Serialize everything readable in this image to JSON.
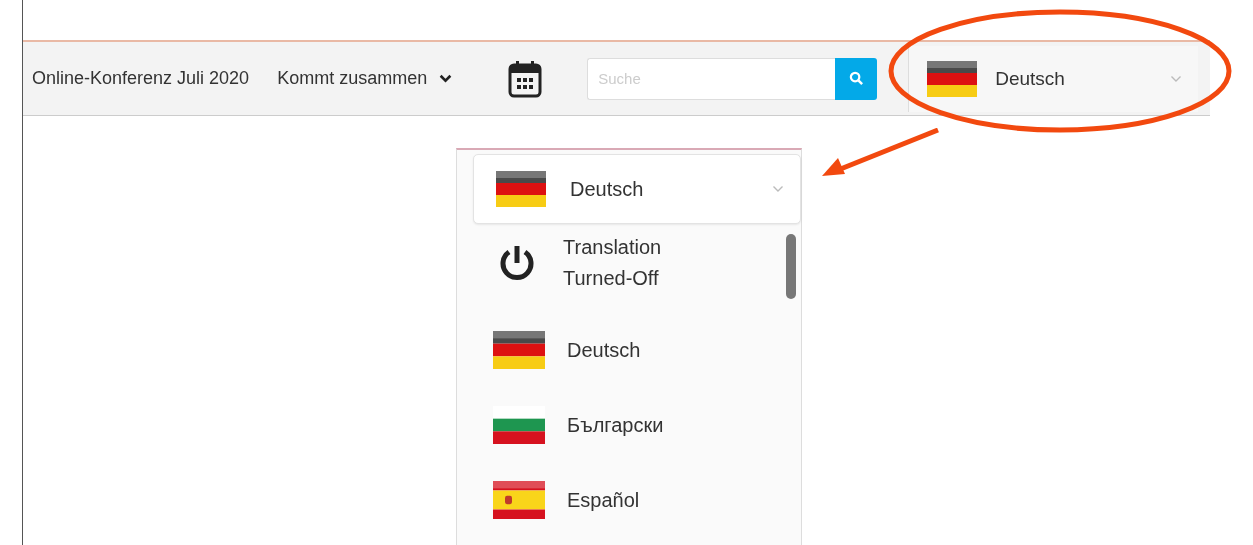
{
  "header": {
    "title": "Online-Konferenz Juli 2020",
    "menu": "Kommt zusammen",
    "search": {
      "placeholder": "Suche"
    },
    "language": {
      "kind": "de",
      "label": "Deutsch"
    }
  },
  "dropdown": {
    "current": {
      "kind": "de",
      "label": "Deutsch"
    },
    "options": [
      {
        "kind": "off",
        "label": "Translation Turned-Off"
      },
      {
        "kind": "de",
        "label": "Deutsch"
      },
      {
        "kind": "bg",
        "label": "Български"
      },
      {
        "kind": "es",
        "label": "Español"
      }
    ]
  }
}
